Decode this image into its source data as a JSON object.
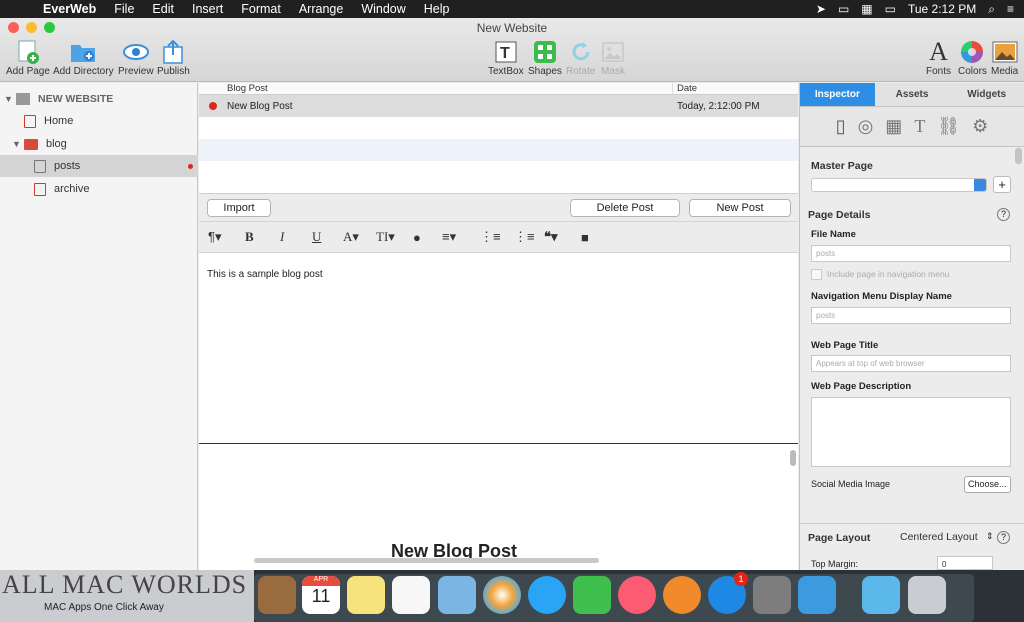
{
  "menubar": {
    "app": "EverWeb",
    "items": [
      "File",
      "Edit",
      "Insert",
      "Format",
      "Arrange",
      "Window",
      "Help"
    ],
    "clock": "Tue 2:12 PM"
  },
  "window": {
    "title": "New Website"
  },
  "toolbar": {
    "add_page": "Add Page",
    "add_directory": "Add Directory",
    "preview": "Preview",
    "publish": "Publish",
    "textbox": "TextBox",
    "shapes": "Shapes",
    "rotate": "Rotate",
    "mask": "Mask",
    "fonts": "Fonts",
    "colors": "Colors",
    "media": "Media"
  },
  "sidebar": {
    "site": "NEW WEBSITE",
    "home": "Home",
    "blog": "blog",
    "posts": "posts",
    "archive": "archive"
  },
  "table": {
    "headers": [
      "Blog Post",
      "Date"
    ],
    "rows": [
      {
        "title": "New Blog Post",
        "date": "Today, 2:12:00 PM"
      }
    ]
  },
  "actions": {
    "import": "Import",
    "delete": "Delete Post",
    "new": "New Post"
  },
  "editor": {
    "text": "This is a sample blog post"
  },
  "preview": {
    "heading": "New Blog Post"
  },
  "inspector": {
    "tabs": [
      "Inspector",
      "Assets",
      "Widgets"
    ],
    "master_page": "Master Page",
    "page_details": "Page Details",
    "file_name_label": "File Name",
    "file_name_value": "posts",
    "include_nav": "Include page in navigation menu",
    "nav_display_label": "Navigation Menu Display Name",
    "nav_display_value": "posts",
    "web_title_label": "Web Page Title",
    "web_title_placeholder": "Appears at top of web browser",
    "web_desc_label": "Web Page Description",
    "social_label": "Social Media Image",
    "choose": "Choose...",
    "page_layout": "Page Layout",
    "layout_value": "Centered Layout",
    "top_margin": "Top Margin:",
    "top_margin_value": "0"
  },
  "watermark": {
    "big": "ALL MAC WORLDS",
    "small": "MAC Apps One Click Away"
  },
  "dock_calendar": {
    "month": "APR",
    "day": "11"
  },
  "dock_badge": "1"
}
